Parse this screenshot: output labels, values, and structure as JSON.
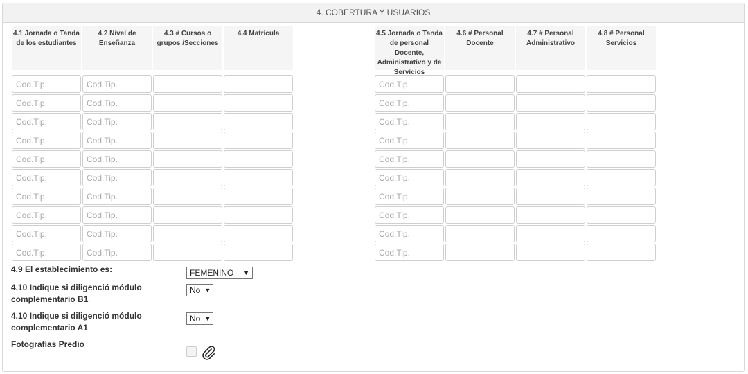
{
  "section": {
    "title": "4. COBERTURA Y USUARIOS"
  },
  "left_table": {
    "headers": [
      "4.1 Jornada o Tanda de los estudiantes",
      "4.2 Nivel de Enseñanza",
      "4.3 # Cursos o grupos /Secciones",
      "4.4 Matrícula"
    ]
  },
  "right_table": {
    "headers": [
      "4.5 Jornada o Tanda de personal Docente, Administrativo y de Servicios",
      "4.6 # Personal Docente",
      "4.7 # Personal Administrativo",
      "4.8 # Personal Servicios"
    ]
  },
  "code_placeholder": "Cod.Tip.",
  "row_count": 10,
  "fields": {
    "establecimiento": {
      "label": "4.9 El establecimiento es:",
      "value": "FEMENINO"
    },
    "modulo_b1": {
      "label": "4.10 Indique si diligenció módulo complementario B1",
      "value": "No"
    },
    "modulo_a1": {
      "label": "4.10 Indique si diligenció módulo complementario A1",
      "value": "No"
    },
    "fotografias": {
      "label": "Fotografías Predio"
    }
  },
  "icons": {
    "select_arrow": "triangle-down-icon",
    "attachment": "paperclip-icon"
  }
}
